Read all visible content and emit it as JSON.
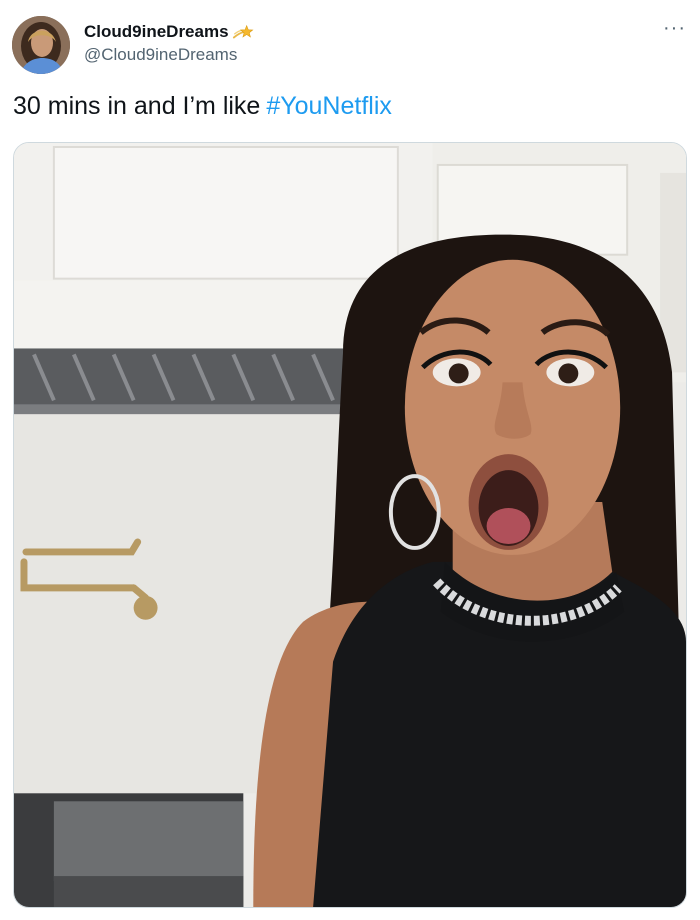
{
  "user": {
    "display_name": "Cloud9ineDreams",
    "handle": "@Cloud9ineDreams",
    "badge_icon": "shooting-star-icon",
    "avatar_icon": "profile-photo"
  },
  "menu": {
    "more_label": "···",
    "icon": "more-horizontal-icon"
  },
  "tweet": {
    "text": "30 mins in and I’m like",
    "hashtag": "#YouNetflix"
  },
  "media": {
    "type": "photo"
  },
  "colors": {
    "link": "#1d9bf0",
    "secondary_text": "#536471",
    "primary_text": "#0f1419"
  }
}
